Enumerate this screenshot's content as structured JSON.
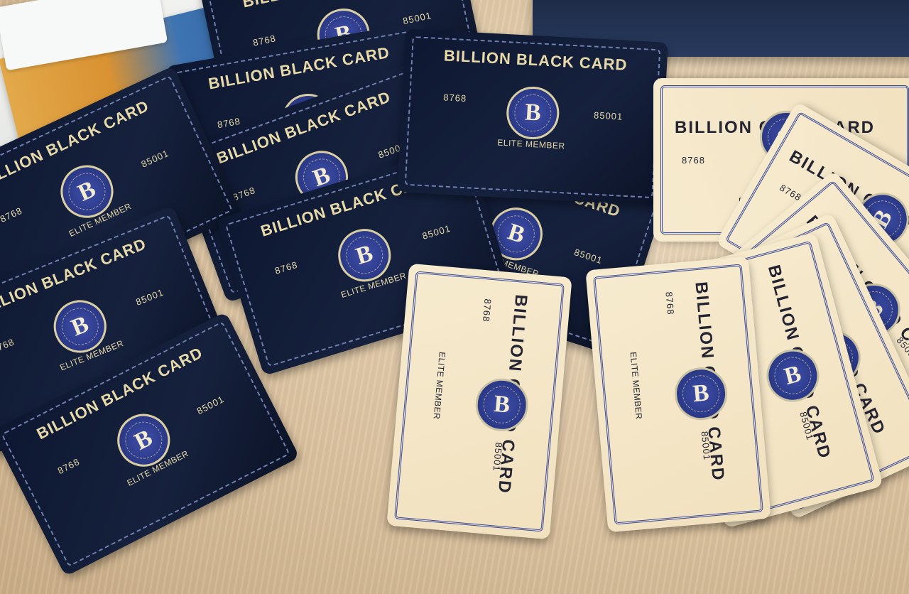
{
  "black_card": {
    "title": "BILLION BLACK CARD",
    "number_left": "8768",
    "number_right": "85001",
    "member_label": "ELITE MEMBER",
    "emblem_letter": "B"
  },
  "gold_card": {
    "title": "BILLION GOLD CARD",
    "number_left": "8768",
    "number_right": "85001",
    "member_label": "ELITE MEMBER",
    "emblem_letter": "B"
  },
  "colors": {
    "black_card_bg": "#0d1730",
    "gold_card_bg": "#f3e4c4",
    "emblem_blue": "#2f3d8f",
    "table_wood": "#dcc3a0"
  }
}
